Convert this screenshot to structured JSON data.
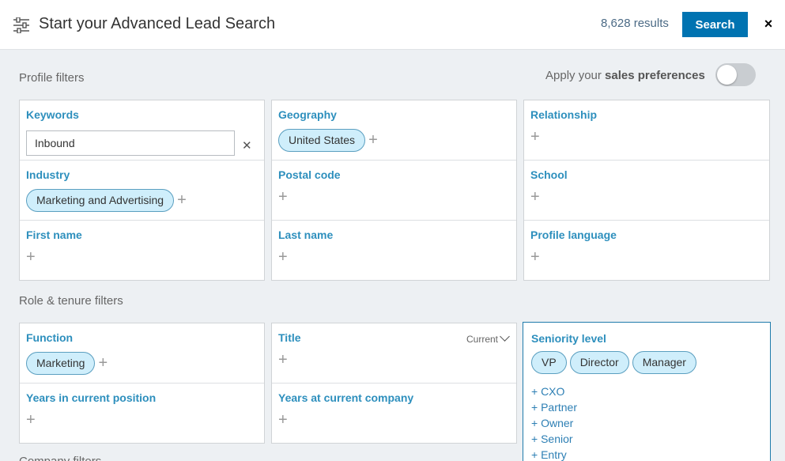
{
  "header": {
    "title": "Start your Advanced Lead Search",
    "results": "8,628 results",
    "search_label": "Search",
    "close_label": "×"
  },
  "sections": {
    "profile": "Profile filters",
    "role": "Role & tenure filters",
    "company_partial": "Company filters"
  },
  "preferences": {
    "prefix": "Apply your ",
    "bold": "sales preferences",
    "enabled": false
  },
  "profile_filters": {
    "keywords": {
      "label": "Keywords",
      "value": "Inbound"
    },
    "industry": {
      "label": "Industry",
      "pills": [
        "Marketing and Advertising"
      ]
    },
    "first_name": {
      "label": "First name"
    },
    "geography": {
      "label": "Geography",
      "pills": [
        "United States"
      ]
    },
    "postal_code": {
      "label": "Postal code"
    },
    "last_name": {
      "label": "Last name"
    },
    "relationship": {
      "label": "Relationship"
    },
    "school": {
      "label": "School"
    },
    "profile_language": {
      "label": "Profile language"
    }
  },
  "role_filters": {
    "function": {
      "label": "Function",
      "pills": [
        "Marketing"
      ]
    },
    "years_current_position": {
      "label": "Years in current position"
    },
    "title": {
      "label": "Title",
      "scope": "Current"
    },
    "years_current_company": {
      "label": "Years at current company"
    },
    "seniority": {
      "label": "Seniority level",
      "selected": [
        "VP",
        "Director",
        "Manager"
      ],
      "options": [
        "+ CXO",
        "+ Partner",
        "+ Owner",
        "+ Senior",
        "+ Entry"
      ]
    }
  },
  "icons": {
    "filter": "sliders-icon",
    "add": "plus-icon",
    "clear": "close-icon"
  },
  "colors": {
    "accent": "#0073b1",
    "label": "#2d8fbd",
    "pill_bg": "#cfeefb"
  }
}
